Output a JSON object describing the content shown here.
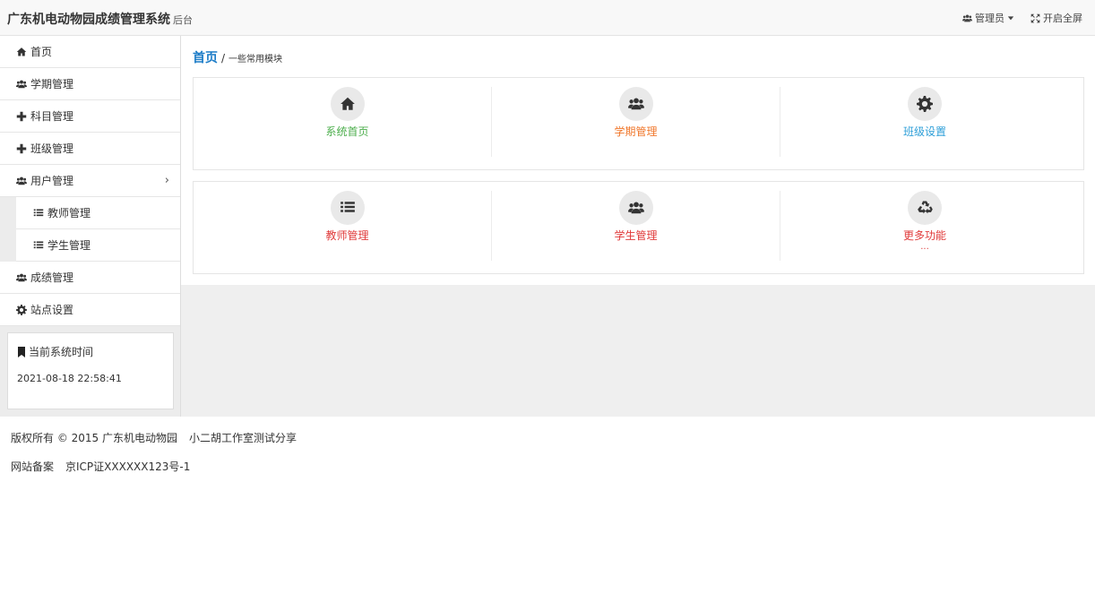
{
  "header": {
    "brand": "广东机电动物园成绩管理系统",
    "brand_sub": "后台",
    "admin_label": "管理员",
    "fullscreen_label": "开启全屏"
  },
  "sidebar": {
    "items": [
      {
        "label": "首页",
        "icon": "home-icon"
      },
      {
        "label": "学期管理",
        "icon": "users-icon"
      },
      {
        "label": "科目管理",
        "icon": "plus-icon"
      },
      {
        "label": "班级管理",
        "icon": "plus-icon"
      },
      {
        "label": "用户管理",
        "icon": "users-icon"
      },
      {
        "label": "教师管理",
        "icon": "list-icon"
      },
      {
        "label": "学生管理",
        "icon": "list-icon"
      },
      {
        "label": "成绩管理",
        "icon": "users-icon"
      },
      {
        "label": "站点设置",
        "icon": "gear-icon"
      }
    ],
    "time_box": {
      "title": "当前系统时间",
      "value": "2021-08-18 22:58:41"
    }
  },
  "main": {
    "breadcrumb": {
      "home": "首页",
      "separator": "/",
      "desc": "一些常用模块"
    },
    "panels": [
      [
        {
          "label": "系统首页",
          "icon": "home-icon",
          "color": "#4cae4c"
        },
        {
          "label": "学期管理",
          "icon": "users-icon",
          "color": "#f0772b"
        },
        {
          "label": "班级设置",
          "icon": "gear-icon",
          "color": "#2e9fd8"
        }
      ],
      [
        {
          "label": "教师管理",
          "icon": "list-icon",
          "color": "#e03a3a"
        },
        {
          "label": "学生管理",
          "icon": "users-icon",
          "color": "#e03a3a"
        },
        {
          "label": "更多功能",
          "icon": "recycle-icon",
          "color": "#e03a3a",
          "more": "..."
        }
      ]
    ]
  },
  "footer": {
    "copyright": "版权所有 © 2015 广东机电动物园",
    "studio": "小二胡工作室测试分享",
    "icp_label": "网站备案",
    "icp_number": "京ICP证XXXXXX123号-1"
  }
}
